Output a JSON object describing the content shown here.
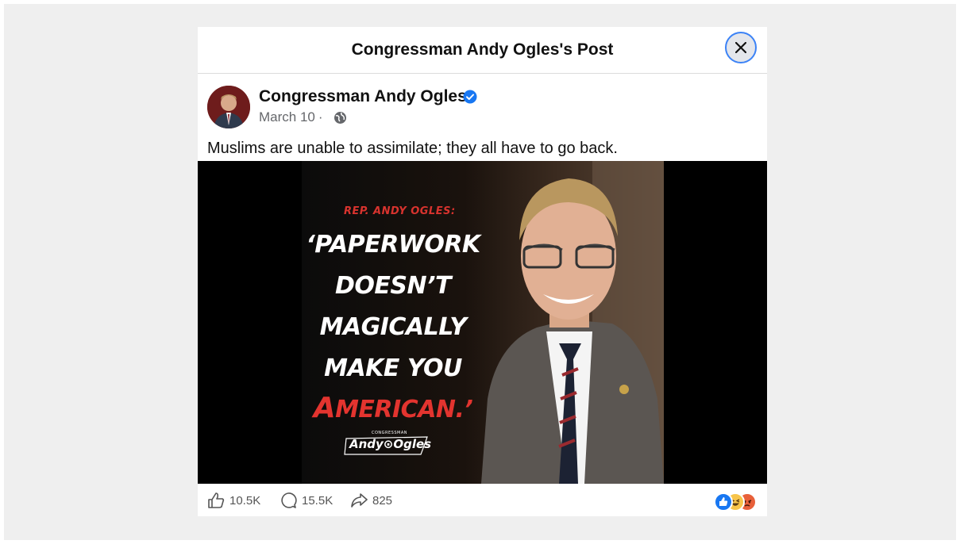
{
  "dialog": {
    "title": "Congressman Andy Ogles's Post"
  },
  "post": {
    "author": "Congressman Andy Ogles",
    "date": "March 10",
    "separator": "·",
    "text": "Muslims are unable to assimilate; they all have to go back."
  },
  "graphic": {
    "kicker": "REP. ANDY OGLES:",
    "quote_lines": [
      "‘PAPERWORK",
      "DOESN’T",
      "MAGICALLY",
      "MAKE YOU"
    ],
    "quote_last_red": "A",
    "quote_last_rest": "MERICAN.’",
    "logo_small": "CONGRESSMAN",
    "logo_name": "Andy⊙Ogles"
  },
  "stats": {
    "likes": "10.5K",
    "comments": "15.5K",
    "shares": "825"
  },
  "colors": {
    "verified": "#1877f2",
    "close_ring": "#3b82f6",
    "quote_red": "#e3342f"
  },
  "icons": [
    "close-icon",
    "verified-badge-icon",
    "globe-icon",
    "like-icon",
    "comment-icon",
    "share-icon",
    "like-reaction-icon",
    "haha-reaction-icon",
    "angry-reaction-icon"
  ]
}
